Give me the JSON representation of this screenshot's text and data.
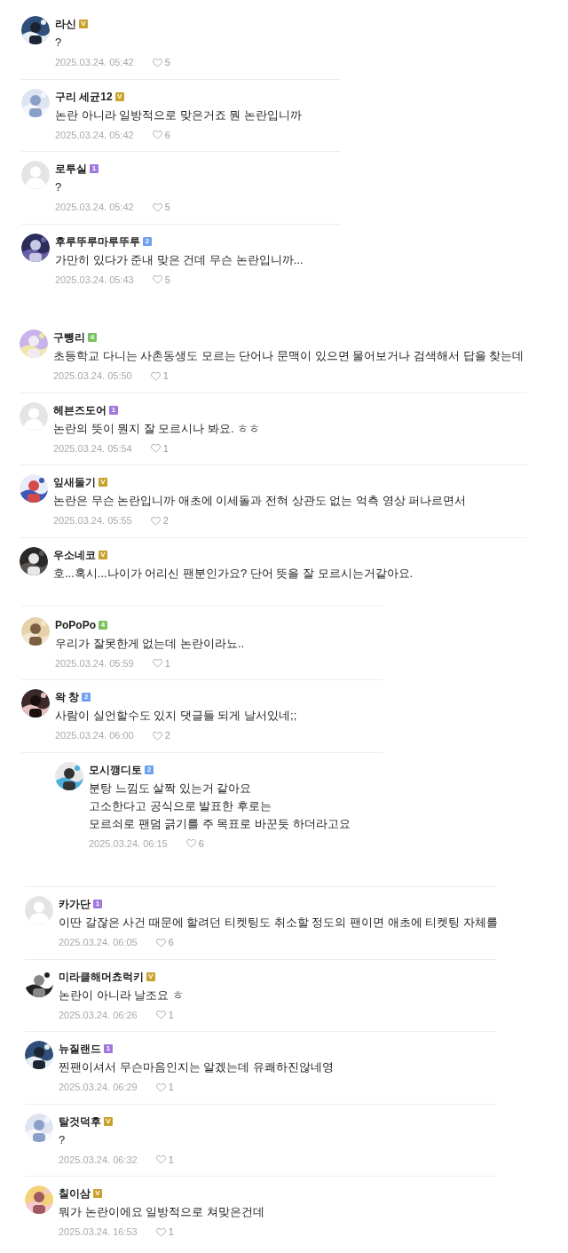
{
  "groups": [
    {
      "comments": [
        {
          "author": "라신",
          "badge": {
            "text": "V",
            "color": "#c8a22c"
          },
          "avatar": {
            "kind": "picture"
          },
          "text": "?",
          "date": "2025.03.24. 05:42",
          "likes": "5"
        },
        {
          "author": "구리 세균12",
          "badge": {
            "text": "V",
            "color": "#c8a22c"
          },
          "avatar": {
            "kind": "picture"
          },
          "text": "논란 아니라 일방적으로 맞은거죠 뭔 논란입니까",
          "date": "2025.03.24. 05:42",
          "likes": "6"
        },
        {
          "author": "로투실",
          "badge": {
            "text": "1",
            "color": "#a078e0"
          },
          "avatar": {
            "kind": "default"
          },
          "text": "?",
          "date": "2025.03.24. 05:42",
          "likes": "5"
        },
        {
          "author": "후루뚜루마루뚜루",
          "badge": {
            "text": "2",
            "color": "#6ea0f0"
          },
          "avatar": {
            "kind": "picture"
          },
          "text": "가만히 있다가 준내 맞은 건데 무슨 논란입니까...",
          "date": "2025.03.24. 05:43",
          "likes": "5"
        }
      ]
    },
    {
      "comments": [
        {
          "author": "구뺑리",
          "badge": {
            "text": "4",
            "color": "#7cc262"
          },
          "avatar": {
            "kind": "picture"
          },
          "text": "초등학교 다니는 사촌동생도 모르는 단어나 문맥이 있으면 물어보거나 검색해서 답을 찾는데",
          "date": "2025.03.24. 05:50",
          "likes": "1"
        },
        {
          "author": "헤븐즈도어",
          "badge": {
            "text": "1",
            "color": "#a078e0"
          },
          "avatar": {
            "kind": "default"
          },
          "text": "논란의 뜻이 뭔지 잘 모르시나 봐요. ㅎㅎ",
          "date": "2025.03.24. 05:54",
          "likes": "1"
        },
        {
          "author": "잎새둘기",
          "badge": {
            "text": "V",
            "color": "#c8a22c"
          },
          "avatar": {
            "kind": "picture"
          },
          "text": "논란은 무슨 논란입니까 애초에 이세돌과 전혀 상관도 없는 억측 영상 퍼나르면서",
          "date": "2025.03.24. 05:55",
          "likes": "2"
        },
        {
          "author": "우소네코",
          "badge": {
            "text": "V",
            "color": "#c8a22c"
          },
          "avatar": {
            "kind": "picture"
          },
          "text": "호...혹시...나이가 어리신 팬분인가요? 단어 뜻을 잘 모르시는거같아요."
        }
      ]
    },
    {
      "comments": [
        {
          "author": "PoPoPo",
          "badge": {
            "text": "4",
            "color": "#7cc262"
          },
          "avatar": {
            "kind": "picture"
          },
          "text": "우리가 잘못한게 없는데 논란이라뇨..",
          "date": "2025.03.24. 05:59",
          "likes": "1"
        },
        {
          "author": "왁 창",
          "badge": {
            "text": "2",
            "color": "#6ea0f0"
          },
          "avatar": {
            "kind": "picture"
          },
          "text": "사람이 실언할수도 있지 댓글들 되게 날서있네;;",
          "date": "2025.03.24. 06:00",
          "likes": "2",
          "replies": [
            {
              "author": "모시깽디토",
              "badge": {
                "text": "2",
                "color": "#6ea0f0"
              },
              "avatar": {
                "kind": "picture"
              },
              "lines": [
                "분탕 느낌도 살짝 있는거 같아요",
                "고소한다고 공식으로 발표한 후로는",
                "모르쇠로 팬덤 긁기를 주 목표로 바꾼듯 하더라고요"
              ],
              "date": "2025.03.24. 06:15",
              "likes": "6"
            }
          ]
        }
      ]
    },
    {
      "comments": [
        {
          "author": "카가단",
          "badge": {
            "text": "1",
            "color": "#a078e0"
          },
          "avatar": {
            "kind": "default"
          },
          "text": "이딴 갈잖은 사건 때문에 할려던 티켓팅도 취소할 정도의 팬이면 애초에 티켓팅 자체를",
          "date": "2025.03.24. 06:05",
          "likes": "6"
        },
        {
          "author": "미라클해머쵸럭키",
          "badge": {
            "text": "V",
            "color": "#c8a22c"
          },
          "avatar": {
            "kind": "picture"
          },
          "text": "논란이 아니라 날조요 ㅎ",
          "date": "2025.03.24. 06:26",
          "likes": "1"
        },
        {
          "author": "뉴질랜드",
          "badge": {
            "text": "1",
            "color": "#a078e0"
          },
          "avatar": {
            "kind": "picture"
          },
          "text": "찐팬이셔서 무슨마음인지는 알겠는데 유쾌하진않네영",
          "date": "2025.03.24. 06:29",
          "likes": "1"
        },
        {
          "author": "탈것덕후",
          "badge": {
            "text": "V",
            "color": "#c8a22c"
          },
          "avatar": {
            "kind": "picture"
          },
          "text": "?",
          "date": "2025.03.24. 06:32",
          "likes": "1"
        },
        {
          "author": "칠이삼",
          "badge": {
            "text": "V",
            "color": "#c8a22c"
          },
          "avatar": {
            "kind": "picture"
          },
          "text": "뭐가 논란이에요 일방적으로 쳐맞은건데",
          "date": "2025.03.24. 16:53",
          "likes": "1"
        }
      ]
    }
  ]
}
